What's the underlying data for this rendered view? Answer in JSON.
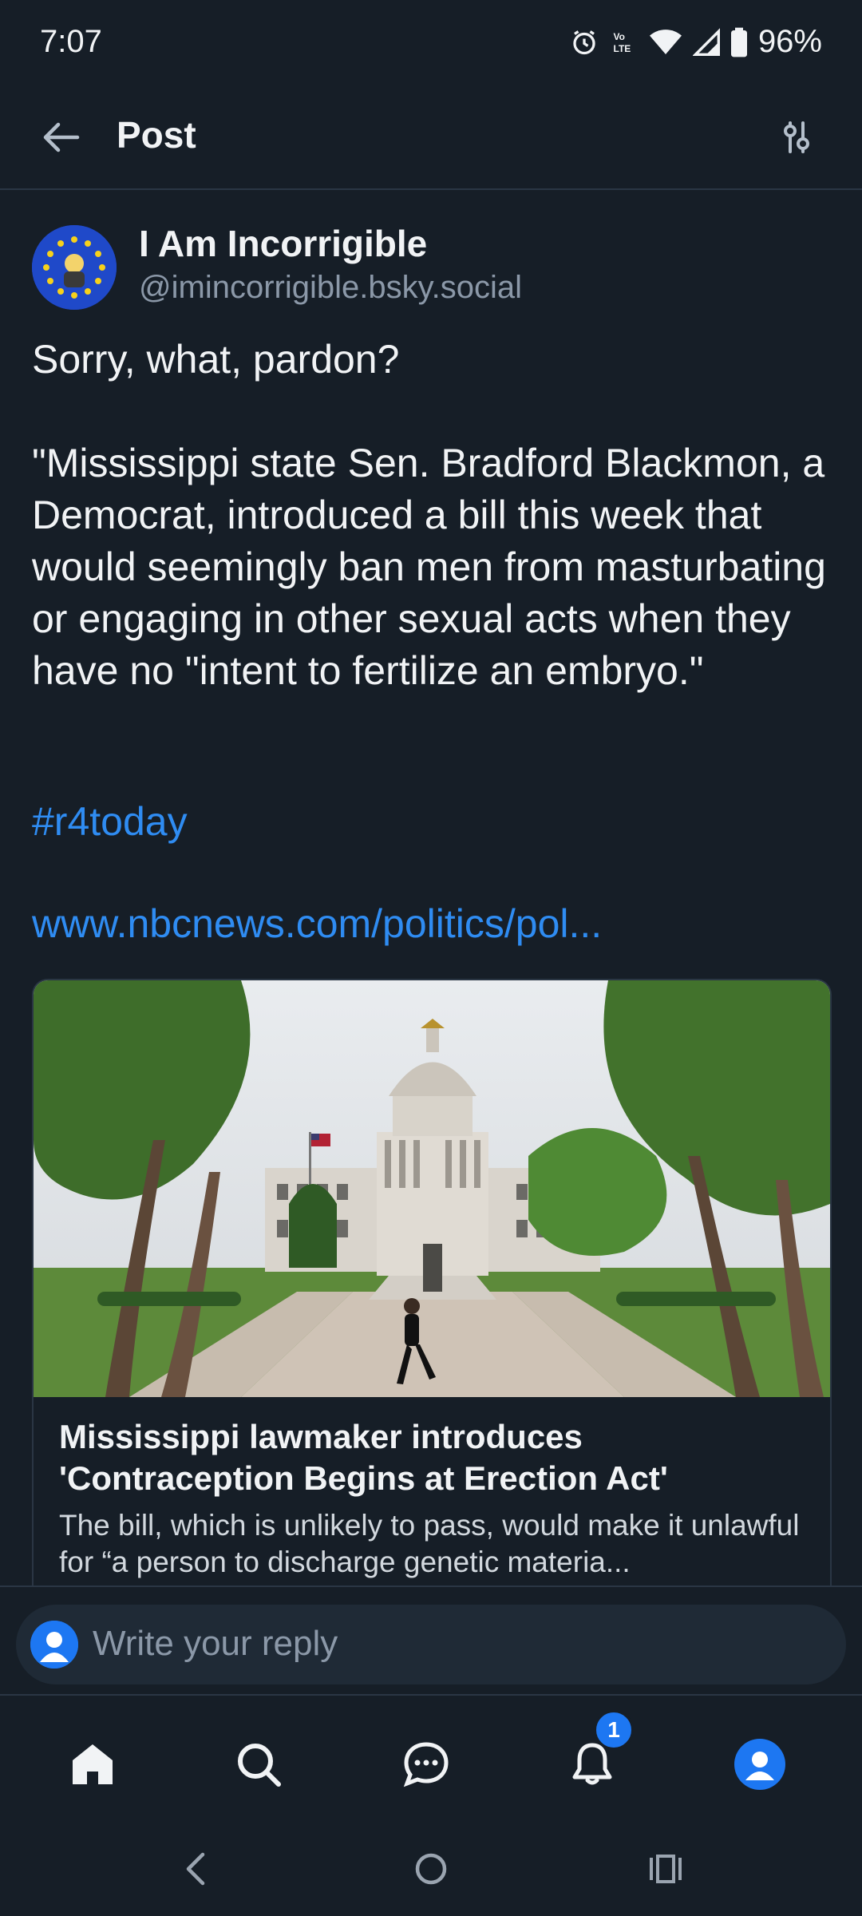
{
  "status_bar": {
    "time": "7:07",
    "battery": "96%",
    "icons": [
      "alarm-icon",
      "volte-icon",
      "wifi-icon",
      "signal-icon",
      "battery-icon"
    ]
  },
  "header": {
    "title": "Post",
    "back_icon": "arrow-left-icon",
    "filter_icon": "sliders-icon"
  },
  "post": {
    "author_name": "I Am Incorrigible",
    "author_handle": "@imincorrigible.bsky.social",
    "text": "Sorry, what, pardon?\n\n\"Mississippi state Sen. Bradford Blackmon, a Democrat, introduced a bill this week that would seemingly ban men from masturbating or engaging in other sexual acts when they have no \"intent to fertilize an embryo.\"",
    "hashtag": "#r4today",
    "link": "www.nbcnews.com/politics/pol..."
  },
  "link_card": {
    "title": "Mississippi lawmaker introduces 'Contraception Begins at Erection Act'",
    "description": "The bill, which is unlikely to pass, would make it unlawful for “a person to discharge genetic materia..."
  },
  "reply": {
    "placeholder": "Write your reply"
  },
  "bottom_nav": {
    "items": [
      "home-icon",
      "search-icon",
      "chat-icon",
      "bell-icon",
      "profile-icon"
    ],
    "notification_count": "1"
  },
  "colors": {
    "background": "#161e27",
    "accent": "#2f8cf2",
    "muted": "#8b98a8",
    "border": "#2a3644"
  }
}
